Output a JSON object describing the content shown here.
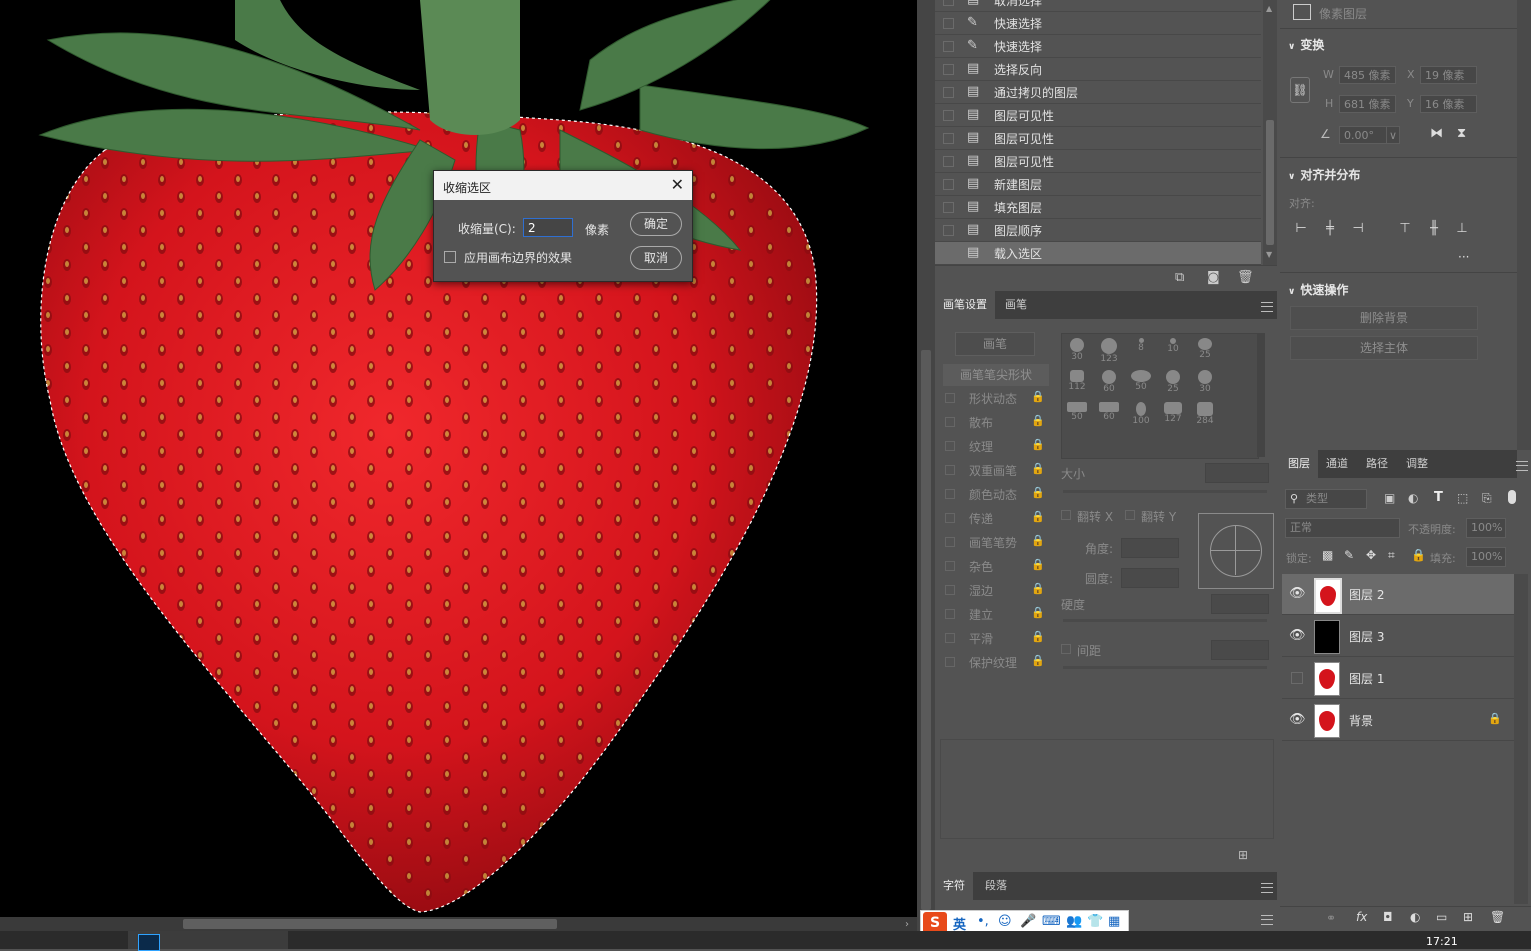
{
  "dialog": {
    "title": "收缩选区",
    "contract_label": "收缩量(C):",
    "contract_value": "2",
    "unit": "像素",
    "apply_canvas_label": "应用画布边界的效果",
    "ok": "确定",
    "cancel": "取消"
  },
  "history": {
    "items": [
      {
        "label": "取消选择"
      },
      {
        "label": "快速选择"
      },
      {
        "label": "快速选择"
      },
      {
        "label": "选择反向"
      },
      {
        "label": "通过拷贝的图层"
      },
      {
        "label": "图层可见性"
      },
      {
        "label": "图层可见性"
      },
      {
        "label": "图层可见性"
      },
      {
        "label": "新建图层"
      },
      {
        "label": "填充图层"
      },
      {
        "label": "图层顺序"
      },
      {
        "label": "载入选区"
      }
    ]
  },
  "brush_panel": {
    "tabs": [
      "画笔设置",
      "画笔"
    ],
    "brush_button": "画笔",
    "tip_shape": "画笔笔尖形状",
    "options": [
      "形状动态",
      "散布",
      "纹理",
      "双重画笔",
      "颜色动态",
      "传递",
      "画笔笔势",
      "杂色",
      "湿边",
      "建立",
      "平滑",
      "保护纹理"
    ],
    "tip_sizes": [
      "30",
      "123",
      "8",
      "10",
      "25",
      "112",
      "60",
      "50",
      "25",
      "30",
      "50",
      "60",
      "100",
      "127",
      "284"
    ],
    "size_label": "大小",
    "flip_x": "翻转 X",
    "flip_y": "翻转 Y",
    "angle_label": "角度:",
    "roundness_label": "圆度:",
    "hardness_label": "硬度",
    "spacing_label": "间距"
  },
  "char_panel": {
    "tabs": [
      "字符",
      "段落"
    ]
  },
  "properties": {
    "header": "像素图层",
    "transform": "变换",
    "w_label": "W",
    "w_value": "485 像素",
    "x_label": "X",
    "x_value": "19 像素",
    "h_label": "H",
    "h_value": "681 像素",
    "y_label": "Y",
    "y_value": "16 像素",
    "angle": "0.00°",
    "align_title": "对齐并分布",
    "align_label": "对齐:",
    "more": "···",
    "quick_actions": "快速操作",
    "remove_bg": "删除背景",
    "select_subject": "选择主体"
  },
  "layers_panel": {
    "tabs": [
      "图层",
      "通道",
      "路径",
      "调整"
    ],
    "filter_kind": "类型",
    "blend_mode": "正常",
    "opacity_label": "不透明度:",
    "opacity": "100%",
    "lock_label": "锁定:",
    "fill_label": "填充:",
    "fill": "100%",
    "layers": [
      {
        "name": "图层 2",
        "visible": true,
        "thumb": "strawberry",
        "selected": true
      },
      {
        "name": "图层 3",
        "visible": true,
        "thumb": "black",
        "selected": false
      },
      {
        "name": "图层 1",
        "visible": false,
        "thumb": "strawberry",
        "selected": false
      },
      {
        "name": "背景",
        "visible": true,
        "thumb": "strawberry",
        "selected": false,
        "locked": true
      }
    ]
  },
  "ime": {
    "lang": "英"
  },
  "clock": "17:21",
  "colors": {
    "strawberry_red": "#d4141c",
    "leaf_green": "#4a7a48",
    "panel_bg": "#535353"
  }
}
